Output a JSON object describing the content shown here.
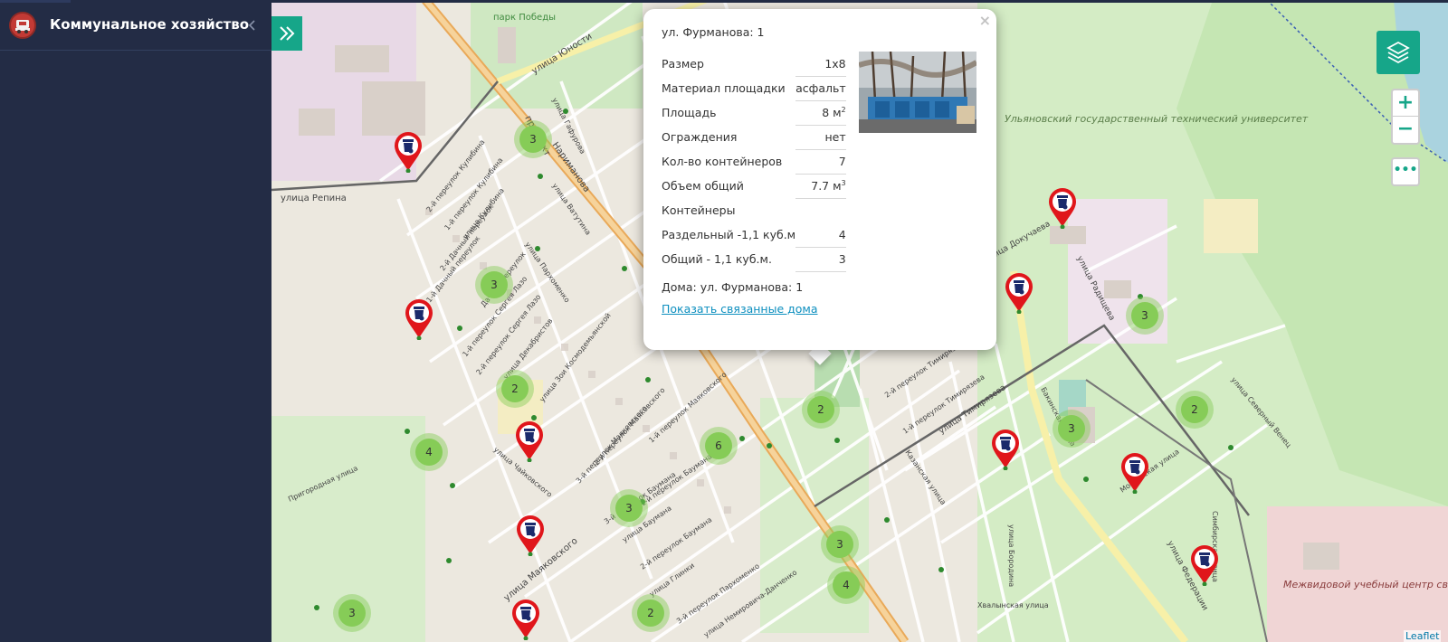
{
  "app": {
    "title": "Коммунальное хозяйство"
  },
  "icons": {
    "logo": "garbage-truck-icon",
    "collapse": "chevron-left-icon",
    "expand": "double-chevron-right-icon",
    "layers": "layers-icon",
    "more": "ellipsis-icon",
    "marker": "trash-bin-marker-icon"
  },
  "colors": {
    "sidebar": "#232c45",
    "accent": "#16a689",
    "marker": "#e0161b",
    "cluster": "#86cc57"
  },
  "map": {
    "zoom_in": "+",
    "zoom_out": "−",
    "more": "•••",
    "attribution": "Leaflet",
    "labels": [
      "парк Победы",
      "улица Юности",
      "улица Гафурова",
      "проспект",
      "Нариманова",
      "улица Репина",
      "2-й переулок Кулибина",
      "1-й переулок Кулибина",
      "улица Кулибина",
      "1-й Дачный переулок",
      "2-й Дачный переулок",
      "Дачный переулок",
      "улица Ватутина",
      "улица Пархоменко",
      "1-й переулок Сергея Лазо",
      "2-й переулок Сергея Лазо",
      "улица Декабристов",
      "улица Зои Космодемьянской",
      "улица Чайковского",
      "улица Маяковского",
      "3-й переулок Маяковского",
      "2-й переулок Маяковского",
      "1-й переулок Маяковского",
      "1-й переулок Баумана",
      "2-й переулок Баумана",
      "3-й переулок Баумана",
      "улица Баумана",
      "улица Глинки",
      "3-й переулок Пархоменко",
      "улица Немировича-Данченко",
      "Пригородная улица",
      "Ульяновский государственный технический университет",
      "улица Докучаева",
      "улица Радищева",
      "2-й переулок Тимирязева",
      "1-й переулок Тимирязева",
      "улица Тимирязева",
      "Казанская улица",
      "Бакинская улица",
      "Симбирская улица",
      "улица Бородина",
      "Хвалынская улица",
      "улица Федерации",
      "Московская улица",
      "улица Северный Венец",
      "Межвидовой учебный центр связи Приволжско-Уральского"
    ],
    "clusters": [
      "3",
      "3",
      "2",
      "4",
      "3",
      "6",
      "2",
      "2",
      "3",
      "4",
      "3",
      "3",
      "2",
      "3"
    ]
  },
  "popup": {
    "address": "ул. Фурманова: 1",
    "close": "×",
    "rows": [
      {
        "label": "Размер",
        "value": "1х8"
      },
      {
        "label": "Материал площадки",
        "value": "асфальт"
      },
      {
        "label": "Площадь",
        "value": "8 м",
        "sup": "2"
      },
      {
        "label": "Ограждения",
        "value": "нет"
      },
      {
        "label": "Кол-во контейнеров",
        "value": "7"
      },
      {
        "label": "Объем общий",
        "value": "7.7 м",
        "sup": "3"
      }
    ],
    "containers_header": "Контейнеры",
    "containers": [
      {
        "label": "Раздельный -1,1 куб.м",
        "value": "4"
      },
      {
        "label": "Общий - 1,1 куб.м.",
        "value": "3"
      }
    ],
    "houses": "Дома: ул. Фурманова: 1",
    "link": "Показать связанные дома"
  }
}
